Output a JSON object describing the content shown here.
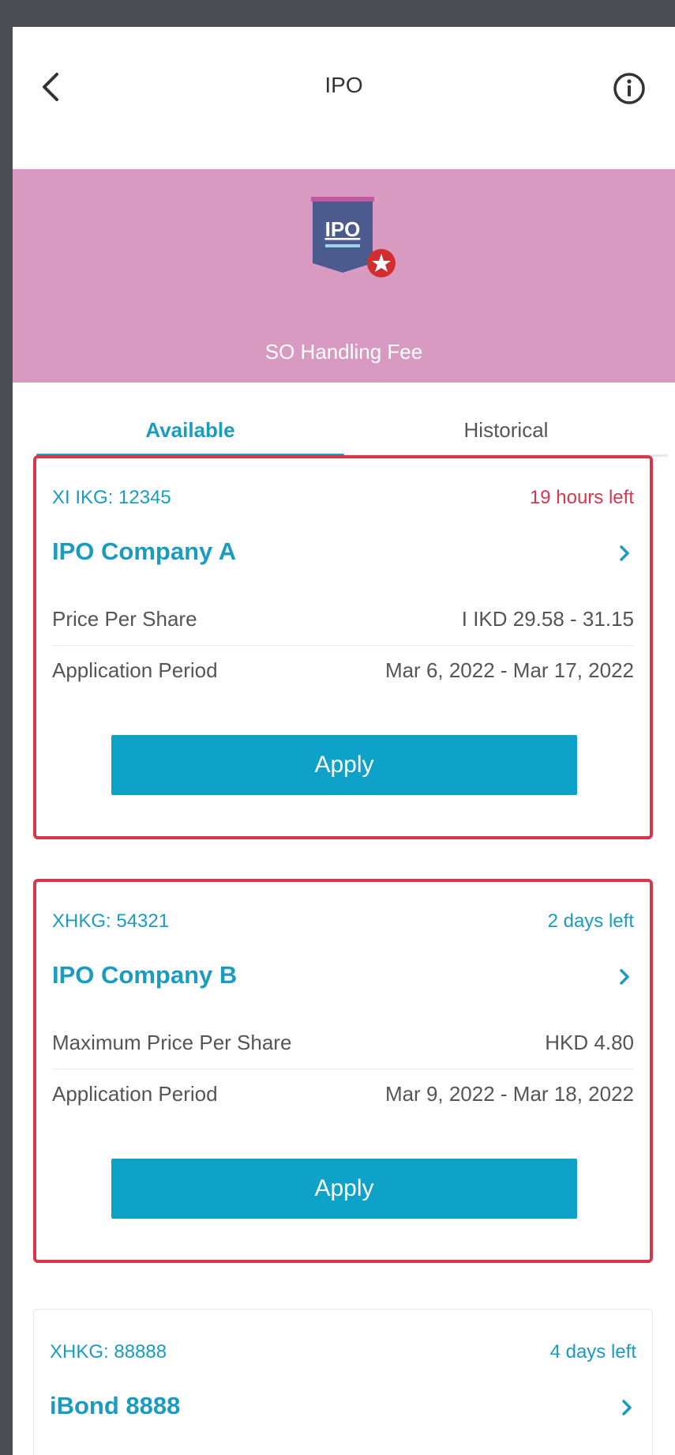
{
  "header": {
    "title": "IPO",
    "back_icon": "chevron-left-icon",
    "info_icon": "info-circle-icon"
  },
  "banner": {
    "badge_text": "IPO",
    "caption": "SO Handling Fee",
    "color": "#d99ac2"
  },
  "tabs": [
    {
      "label": "Available",
      "active": true
    },
    {
      "label": "Historical",
      "active": false
    }
  ],
  "cards": [
    {
      "code": "XI IKG: 12345",
      "time_left": "19 hours left",
      "name": "IPO Company A",
      "rows": [
        {
          "label": "Price Per Share",
          "value": "I IKD 29.58 - 31.15"
        },
        {
          "label": "Application Period",
          "value": "Mar 6, 2022 -  Mar 17, 2022"
        }
      ],
      "button": "Apply"
    },
    {
      "code": "XHKG: 54321",
      "time_left": "2 days left",
      "name": "IPO Company B",
      "rows": [
        {
          "label": "Maximum Price Per Share",
          "value": "HKD 4.80"
        },
        {
          "label": "Application Period",
          "value": "Mar 9, 2022 -  Mar 18, 2022"
        }
      ],
      "button": "Apply"
    },
    {
      "code": "XHKG: 88888",
      "time_left": "4 days left",
      "name": "iBond 8888"
    }
  ],
  "colors": {
    "accent": "#1a9cbf",
    "warning": "#d6384b",
    "button": "#0ea2c9"
  }
}
